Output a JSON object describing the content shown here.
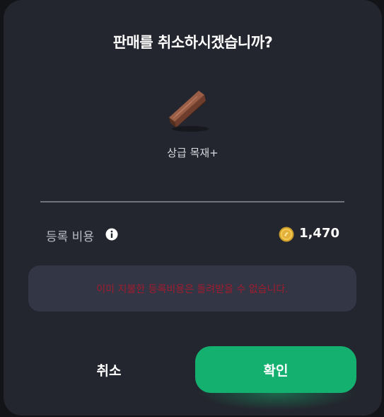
{
  "dialog": {
    "title": "판매를 취소하시겠습니까?",
    "item": {
      "name": "상급 목재+",
      "icon": "wooden-plank-icon"
    },
    "fee": {
      "label": "등록 비용",
      "info_icon": "info-icon",
      "currency_icon": "gold-coin-icon",
      "value": "1,470"
    },
    "notice": {
      "text": "이미 지불한 등록비용은 돌려받을 수 없습니다."
    },
    "buttons": {
      "cancel_label": "취소",
      "confirm_label": "확인"
    }
  },
  "colors": {
    "dialog_background": "#23262e",
    "notice_background": "#323645",
    "notice_text": "#a01c2e",
    "confirm_button": "#14b070"
  }
}
